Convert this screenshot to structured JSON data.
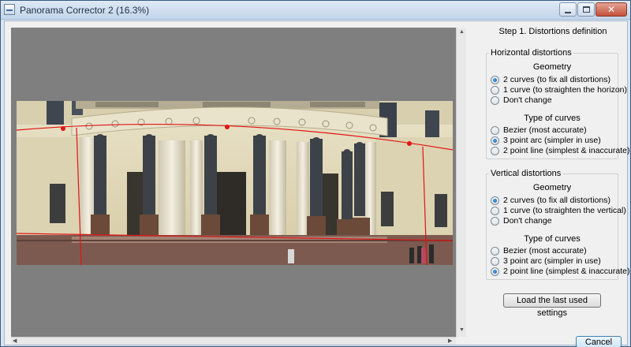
{
  "window": {
    "title": "Panorama Corrector 2 (16.3%)"
  },
  "panel": {
    "step_title": "Step 1. Distortions definition",
    "horizontal": {
      "title": "Horizontal distortions",
      "geometry_title": "Geometry",
      "geometry_options": [
        {
          "label": "2 curves (to fix all distortions)",
          "selected": true
        },
        {
          "label": "1 curve  (to straighten the horizon)",
          "selected": false
        },
        {
          "label": "Don't change",
          "selected": false
        }
      ],
      "curves_title": "Type of curves",
      "curve_options": [
        {
          "label": "Bezier  (most accurate)",
          "selected": false
        },
        {
          "label": "3 point arc  (simpler in use)",
          "selected": true
        },
        {
          "label": "2 point line  (simplest & inaccurate)",
          "selected": false
        }
      ]
    },
    "vertical": {
      "title": "Vertical distortions",
      "geometry_title": "Geometry",
      "geometry_options": [
        {
          "label": "2 curves (to fix all distortions)",
          "selected": true
        },
        {
          "label": "1 curve  (to straighten the vertical)",
          "selected": false
        },
        {
          "label": "Don't change",
          "selected": false
        }
      ],
      "curves_title": "Type of curves",
      "curve_options": [
        {
          "label": "Bezier  (most accurate)",
          "selected": false
        },
        {
          "label": "3 point arc  (simpler in use)",
          "selected": false
        },
        {
          "label": "2 point line  (simplest & inaccurate)",
          "selected": true
        }
      ]
    },
    "load_button": "Load the last used settings",
    "cancel_button": "Cancel"
  },
  "colors": {
    "guide_line": "#e01515",
    "accent": "#1a5fa8"
  }
}
